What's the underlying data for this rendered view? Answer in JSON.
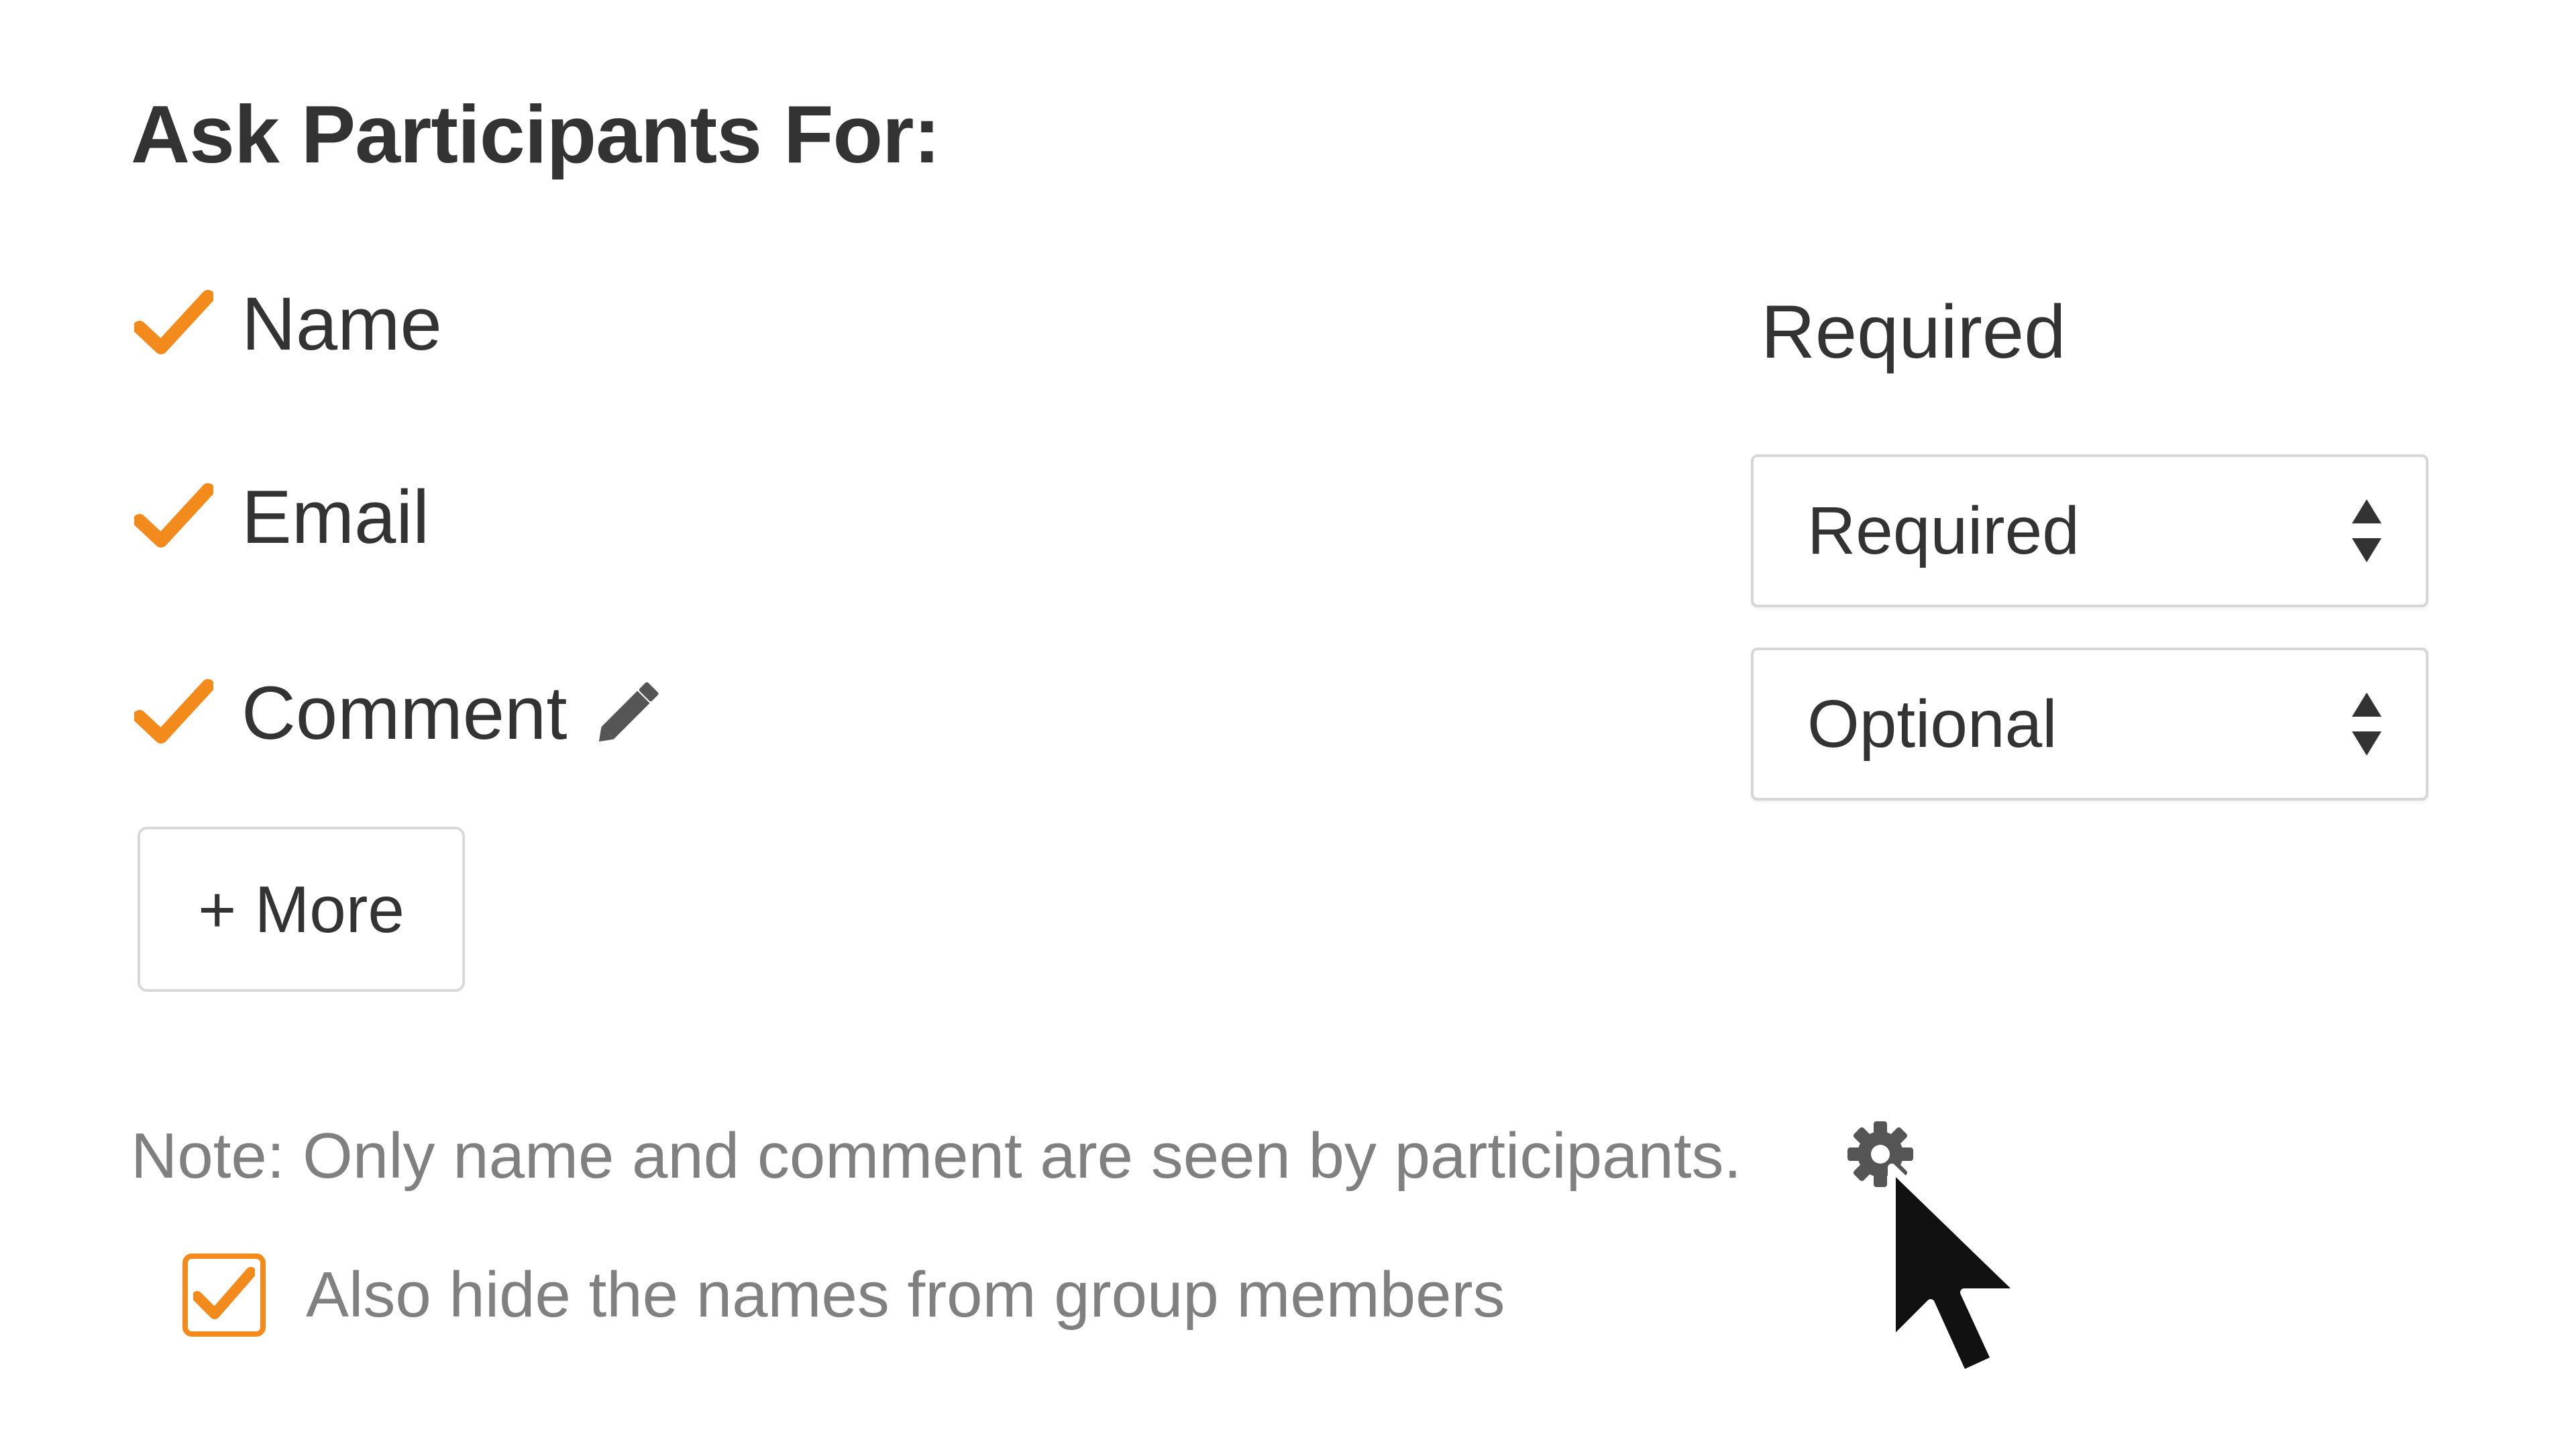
{
  "heading": "Ask Participants For:",
  "fields": [
    {
      "label": "Name",
      "requirement": "Required",
      "editable": false
    },
    {
      "label": "Email",
      "requirement": "Required",
      "editable": true
    },
    {
      "label": "Comment",
      "requirement": "Optional",
      "editable": true
    }
  ],
  "more_button": "+ More",
  "note": "Note: Only name and comment are seen by participants.",
  "hide_names": {
    "label": "Also hide the names from group members",
    "checked": true
  },
  "icons": {
    "check": "check-icon",
    "pencil": "pencil-icon",
    "select_arrows": "select-arrows-icon",
    "gear": "gear-icon",
    "cursor": "mouse-pointer-icon"
  },
  "colors": {
    "accent": "#f28a1c",
    "text": "#333333",
    "muted_text": "#808080",
    "border": "#d6d6d6"
  }
}
